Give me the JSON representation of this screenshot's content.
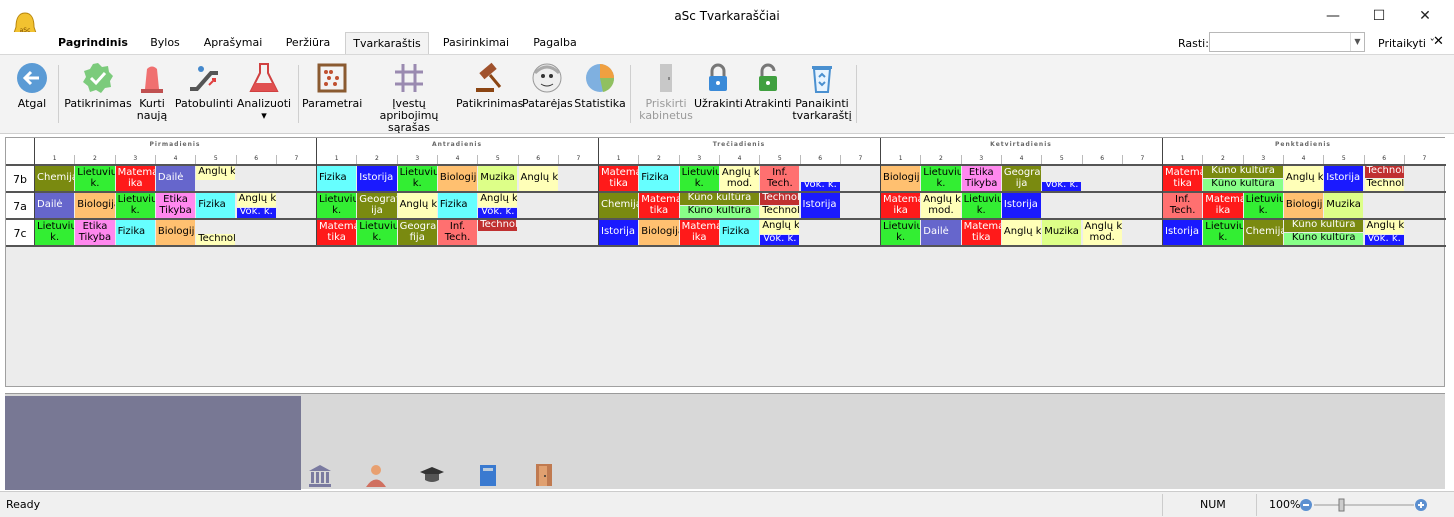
{
  "window": {
    "title": "aSc Tvarkaraščiai",
    "minimize": "—",
    "maximize": "☐",
    "close": "✕"
  },
  "menu": {
    "tabs": [
      {
        "label": "Pagrindinis"
      },
      {
        "label": "Bylos"
      },
      {
        "label": "Aprašymai"
      },
      {
        "label": "Peržiūra"
      },
      {
        "label": "Tvarkaraštis"
      },
      {
        "label": "Pasirinkimai"
      },
      {
        "label": "Pagalba"
      }
    ],
    "search_label": "Rasti:",
    "search_value": "",
    "customize": "Pritaikyti ˇ",
    "close": "✕"
  },
  "ribbon": {
    "back": "Atgal",
    "check": "Patikrinimas",
    "create1": "Kurti",
    "create2": "naują",
    "improve": "Patobulinti",
    "analyze": "Analizuoti",
    "analyze_arrow": "▾",
    "params": "Parametrai",
    "constraints1": "Įvestų apribojimų",
    "constraints2": "sąrašas",
    "check2": "Patikrinimas",
    "advisor": "Patarėjas",
    "stats": "Statistika",
    "assign1": "Priskirti",
    "assign2": "kabinetus",
    "lock": "Užrakinti",
    "unlock": "Atrakinti",
    "delete1": "Panaikinti",
    "delete2": "tvarkaraštį",
    "icons": [
      "back-icon",
      "check-icon",
      "siren-icon",
      "escalator-icon",
      "flask-icon",
      "abacus-icon",
      "grid-icon",
      "gavel-icon",
      "advisor-icon",
      "pie-chart-icon",
      "room-icon",
      "lock-icon",
      "unlock-icon",
      "recycle-icon"
    ]
  },
  "timetable": {
    "days": [
      "Pirmadienis",
      "Antradienis",
      "Trečiadienis",
      "Ketvirtadienis",
      "Penktadienis"
    ],
    "periods": [
      "1",
      "2",
      "3",
      "4",
      "5",
      "6",
      "7"
    ],
    "classes": [
      "7b",
      "7a",
      "7c"
    ]
  },
  "status": {
    "ready": "Ready",
    "num": "NUM",
    "zoom": "100%",
    "minus": "−",
    "plus": "+"
  },
  "colors": {
    "red": "#ff1a1a",
    "green": "#33ee33",
    "blue": "#1a1aff",
    "olive": "#7a8a10",
    "cyan": "#66ffff",
    "orange": "#ffc070",
    "lightyellow": "#ffffb8",
    "pink": "#ff88ee",
    "purple": "#6666cc",
    "lightgreen": "#88ff88",
    "yellowgreen": "#ddff88",
    "salmon": "#ff7070",
    "darkred": "#c03030"
  }
}
